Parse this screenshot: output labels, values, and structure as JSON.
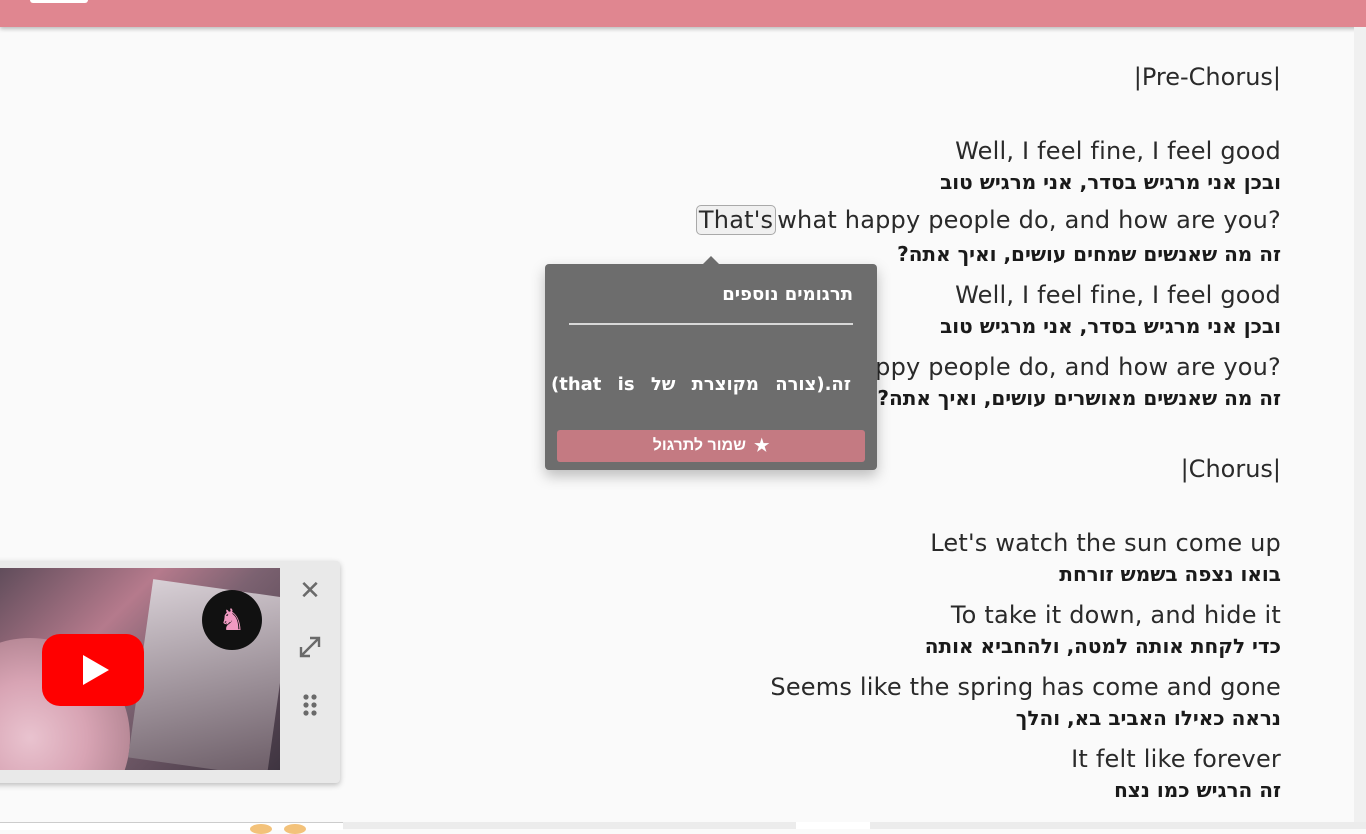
{
  "lyrics": {
    "pre_chorus_label": "|Pre-Chorus|",
    "chorus_label": "|Chorus|",
    "lines": [
      {
        "en": "Well, I feel fine, I feel good",
        "he": "ובכן אני מרגיש בסדר, אני מרגיש טוב"
      },
      {
        "en_word": "That's",
        "en_rest": "what happy people do, and how are you?",
        "he": "זה מה שאנשים שמחים עושים, ואיך אתה?"
      },
      {
        "en": "Well, I feel fine, I feel good",
        "he": "ובכן אני מרגיש בסדר, אני מרגיש טוב"
      },
      {
        "en": "That's what happy people do, and how are you?",
        "he": "זה מה שאנשים מאושרים עושים, ואיך אתה?"
      },
      {
        "en": "Let's watch the sun come up",
        "he": "בואו נצפה בשמש זורחת"
      },
      {
        "en": "To take it down, and hide it",
        "he": "כדי לקחת אותה למטה, ולהחביא אותה"
      },
      {
        "en": "Seems like the spring has come and gone",
        "he": "נראה כאילו האביב בא, והלך"
      },
      {
        "en": "It felt like forever",
        "he": "זה הרגיש כמו נצח"
      }
    ]
  },
  "popup": {
    "title": "תרגומים נוספים",
    "translation": "זה.(צורה מקוצרת של that is)",
    "save_label": "שמור לתרגול"
  },
  "player": {
    "close_icon": "close-icon",
    "expand_icon": "expand-icon",
    "drag_icon": "drag-handle-icon"
  },
  "colors": {
    "topbar": "#e08690",
    "popup_bg": "#6d6d6d",
    "save_button": "#c47a82",
    "youtube_red": "#ff0000"
  }
}
